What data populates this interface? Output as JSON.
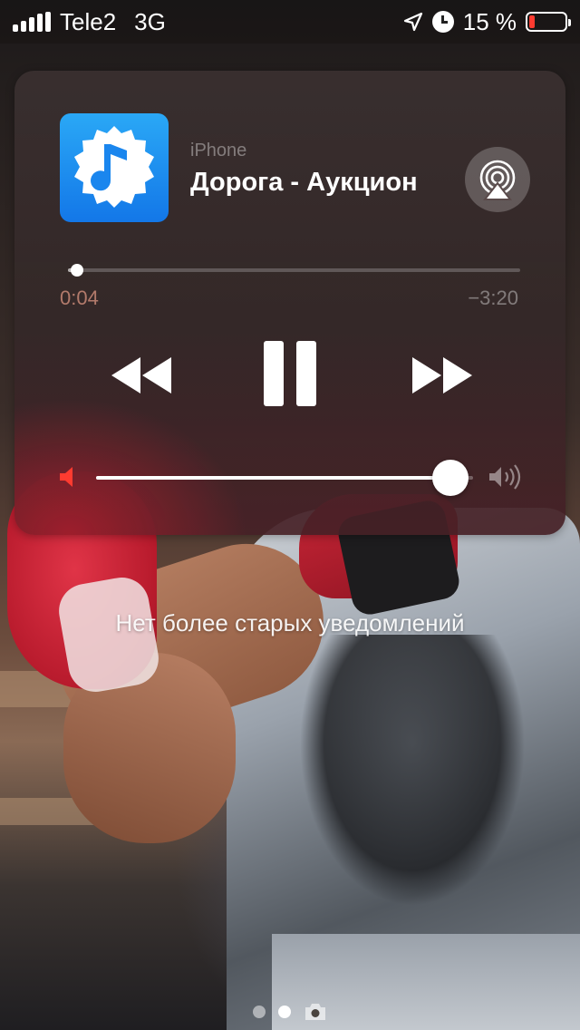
{
  "status_bar": {
    "carrier": "Tele2",
    "network": "3G",
    "battery_percent": "15 %",
    "battery_level": 0.15,
    "icons": [
      "signal-icon",
      "location-arrow-icon",
      "alarm-icon",
      "battery-icon"
    ]
  },
  "now_playing": {
    "source": "iPhone",
    "title": "Дорога - Аукцион",
    "elapsed": "0:04",
    "remaining": "−3:20",
    "progress_fraction": 0.02,
    "volume_fraction": 0.94,
    "app_icon": "music-note-app-icon",
    "icons": [
      "airplay-icon",
      "rewind-icon",
      "pause-icon",
      "forward-icon",
      "volume-min-icon",
      "volume-max-icon"
    ],
    "accent_color": "#ff3b30"
  },
  "notifications": {
    "empty_text": "Нет более старых уведомлений"
  },
  "pager": {
    "pages": 3,
    "active_index": 1,
    "last_icon": "camera-icon"
  }
}
